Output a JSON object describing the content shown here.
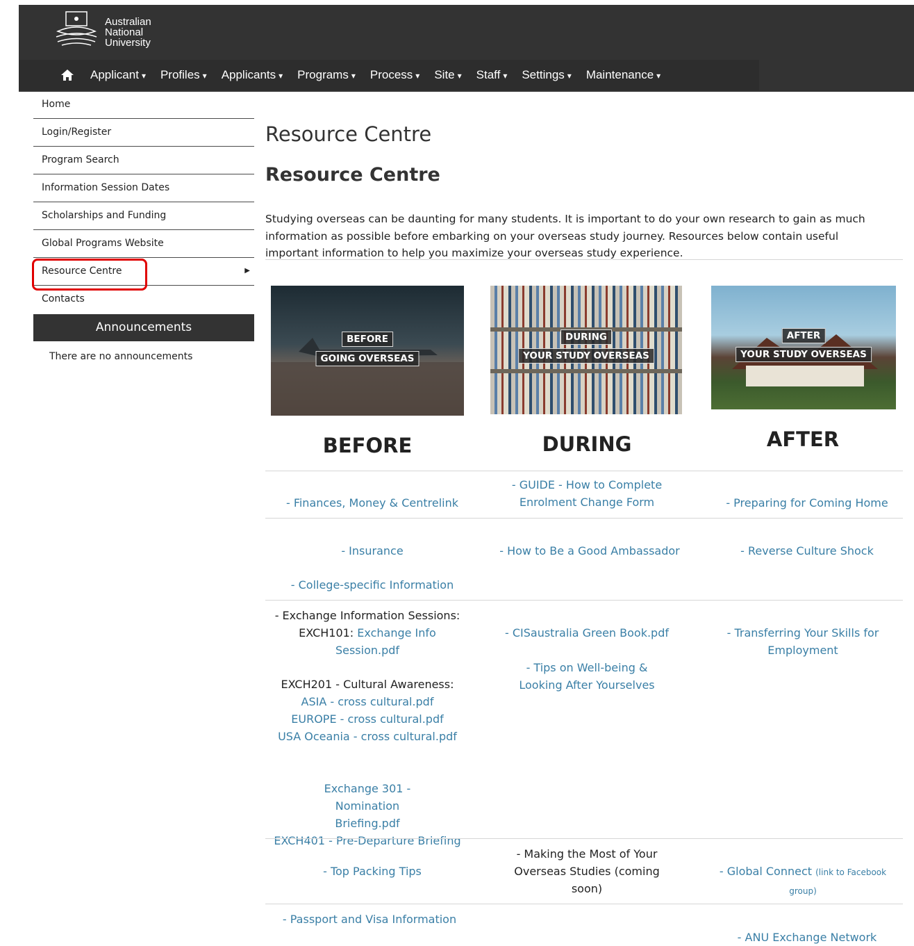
{
  "header": {
    "logo_lines": [
      "Australian",
      "National",
      "University"
    ],
    "nav": [
      {
        "label": "Applicant"
      },
      {
        "label": "Profiles"
      },
      {
        "label": "Applicants"
      },
      {
        "label": "Programs"
      },
      {
        "label": "Process"
      },
      {
        "label": "Site"
      },
      {
        "label": "Staff"
      },
      {
        "label": "Settings"
      },
      {
        "label": "Maintenance"
      }
    ]
  },
  "sidebar": {
    "items": [
      {
        "label": "Home"
      },
      {
        "label": "Login/Register"
      },
      {
        "label": "Program Search"
      },
      {
        "label": "Information Session Dates"
      },
      {
        "label": "Scholarships and Funding"
      },
      {
        "label": "Global Programs Website"
      },
      {
        "label": "Resource Centre"
      },
      {
        "label": "Contacts"
      }
    ],
    "announcements_title": "Announcements",
    "announcements_empty": "There are no announcements"
  },
  "main": {
    "title": "Resource Centre",
    "subtitle": "Resource Centre",
    "intro": "Studying overseas can be daunting for many students. It is important to do your own research to gain as much information as possible before embarking on your overseas study journey. Resources below contain useful important information to help you maximize your overseas study experience.",
    "images": [
      {
        "line1": "BEFORE",
        "line2": "GOING OVERSEAS"
      },
      {
        "line1": "DURING",
        "line2": "YOUR STUDY OVERSEAS"
      },
      {
        "line1": "AFTER",
        "line2": "YOUR STUDY OVERSEAS"
      }
    ],
    "columns": [
      "BEFORE",
      "DURING",
      "AFTER"
    ],
    "before": {
      "finances": "- Finances, Money & Centrelink",
      "insurance": "- Insurance",
      "college": "- College-specific Information",
      "exch_sessions": "- Exchange Information Sessions:",
      "exch101_prefix": "EXCH101: ",
      "exch101_link": "Exchange Info Session.pdf",
      "exch201": "EXCH201 - Cultural Awareness:",
      "asia": "ASIA - cross cultural.pdf",
      "europe": "EUROPE - cross cultural.pdf",
      "usa": "USA Oceania - cross cultural.pdf",
      "exch301": "Exchange 301 - Nomination Briefing.pdf",
      "exch401": "EXCH401 - Pre-Departure Briefing",
      "packing": "- Top Packing Tips",
      "passport": "- Passport and Visa Information"
    },
    "during": {
      "guide": "- GUIDE - How to Complete Enrolment Change Form",
      "ambassador": "- How to Be a Good Ambassador",
      "green_book": "- CISaustralia Green Book.pdf",
      "wellbeing": "- Tips on Well-being & Looking After Yourselves",
      "making_most": "- Making the Most of Your Overseas Studies (coming soon)"
    },
    "after": {
      "preparing": "- Preparing for Coming Home",
      "culture_shock": "- Reverse Culture Shock",
      "skills": "- Transferring Your Skills for Employment",
      "global_connect": "- Global Connect",
      "global_connect_note": "(link to Facebook group)",
      "anu_network": "- ANU Exchange Network"
    }
  }
}
